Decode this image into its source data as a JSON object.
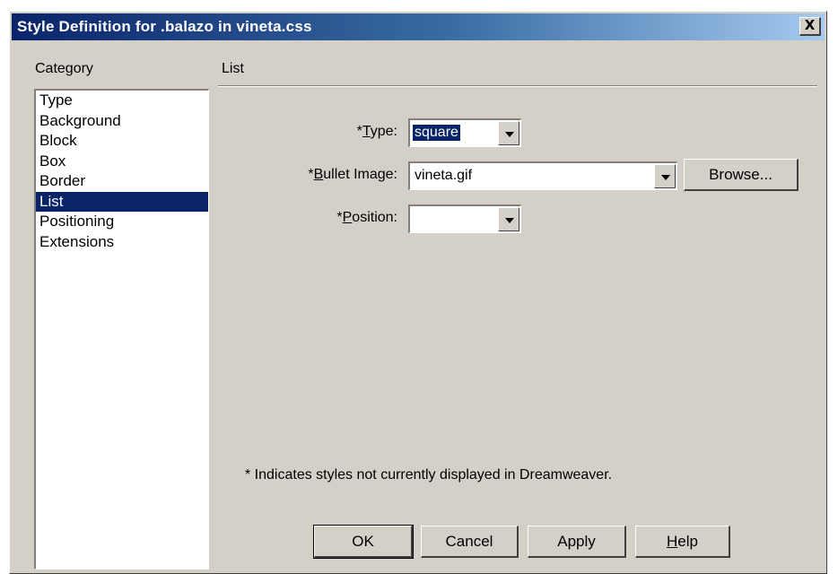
{
  "window": {
    "title": "Style Definition for .balazo in vineta.css",
    "close_label": "X"
  },
  "category": {
    "heading": "Category",
    "items": [
      "Type",
      "Background",
      "Block",
      "Box",
      "Border",
      "List",
      "Positioning",
      "Extensions"
    ],
    "selected": "List"
  },
  "section": {
    "title": "List"
  },
  "fields": {
    "type": {
      "label_prefix": "*",
      "label_key": "T",
      "label_rest": "ype:",
      "value": "square"
    },
    "bullet_image": {
      "label_prefix": "*",
      "label_key": "B",
      "label_rest": "ullet Image:",
      "value": "vineta.gif"
    },
    "position": {
      "label_prefix": "*",
      "label_key": "P",
      "label_rest": "osition:",
      "value": ""
    }
  },
  "browse_label": "Browse...",
  "note": "* Indicates styles not currently displayed in Dreamweaver.",
  "buttons": {
    "ok": "OK",
    "cancel": "Cancel",
    "apply": "Apply",
    "help_key": "H",
    "help_rest": "elp"
  },
  "colors": {
    "dialog_bg": "#d4d0c8",
    "selection": "#0a246a",
    "title_gradient_start": "#0a246a",
    "title_gradient_end": "#a6caf0"
  }
}
